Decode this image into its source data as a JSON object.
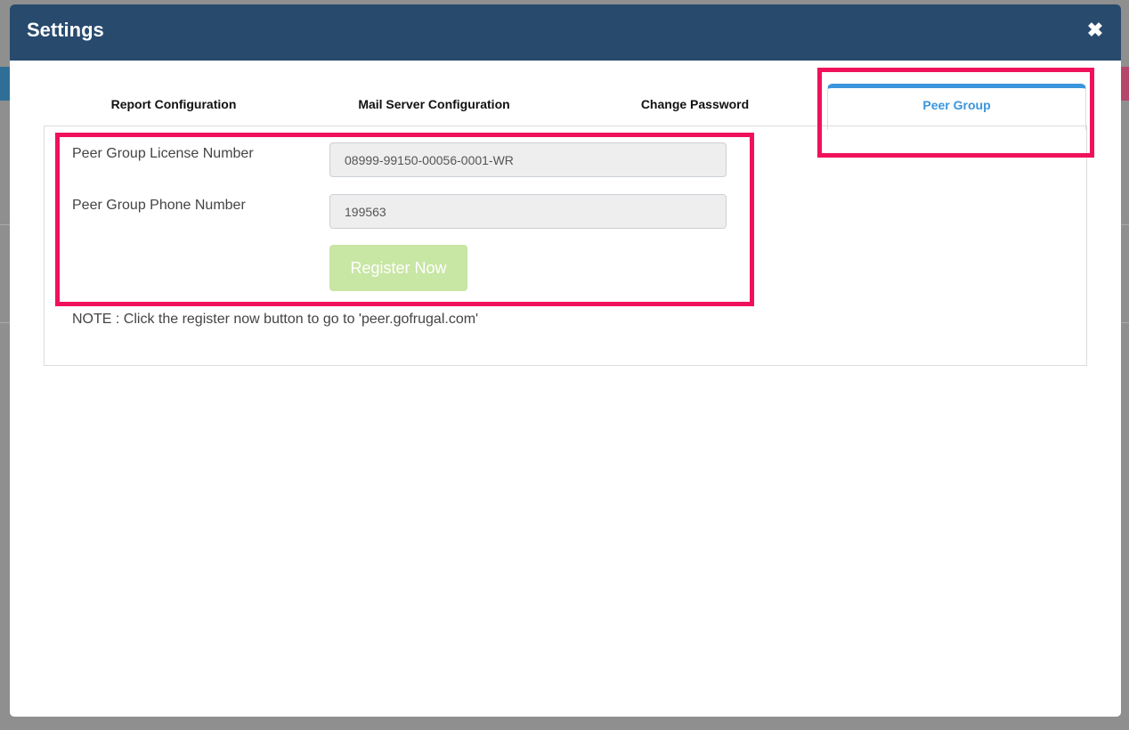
{
  "dialog": {
    "title": "Settings",
    "close_icon": "close-icon"
  },
  "tabs": [
    {
      "label": "Report Configuration",
      "active": false
    },
    {
      "label": "Mail Server Configuration",
      "active": false
    },
    {
      "label": "Change Password",
      "active": false
    },
    {
      "label": "Peer Group",
      "active": true
    }
  ],
  "peer_group": {
    "license_label": "Peer Group License Number",
    "license_value": "08999-99150-00056-0001-WR",
    "phone_label": "Peer Group Phone Number",
    "phone_value": "199563",
    "register_label": "Register Now",
    "note": "NOTE : Click the register now button to go to 'peer.gofrugal.com'"
  },
  "colors": {
    "header": "#284a6d",
    "active_tab": "#3a95dc",
    "register_button": "#c8e6a4",
    "highlight": "#f0115a"
  }
}
